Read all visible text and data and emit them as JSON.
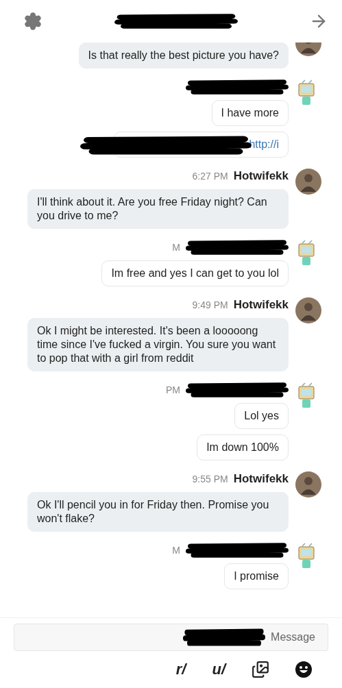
{
  "header": {
    "title_redacted": true
  },
  "groups": [
    {
      "kind": "them",
      "cut_top": true,
      "messages": [
        {
          "kind": "text",
          "text": "Is that really the best picture you have?"
        }
      ]
    },
    {
      "kind": "me",
      "header_redacted": true,
      "messages": [
        {
          "kind": "text",
          "text": "I have more"
        },
        {
          "kind": "link",
          "text": "http://i",
          "redacted": true
        }
      ]
    },
    {
      "kind": "them",
      "name": "Hotwifekk",
      "time": "6:27 PM",
      "messages": [
        {
          "kind": "text",
          "text": "I'll think about it. Are you free Friday night? Can you drive to me?"
        }
      ]
    },
    {
      "kind": "me",
      "header_redacted": true,
      "time": "M",
      "messages": [
        {
          "kind": "text",
          "text": "Im free and yes I can get to you lol"
        }
      ]
    },
    {
      "kind": "them",
      "name": "Hotwifekk",
      "time": "9:49 PM",
      "messages": [
        {
          "kind": "text",
          "text": "Ok I might be interested. It's been a looooong time since I've fucked a virgin. You sure you want to pop that with a girl from reddit"
        }
      ]
    },
    {
      "kind": "me",
      "header_redacted": true,
      "time": "PM",
      "messages": [
        {
          "kind": "text",
          "text": "Lol yes"
        },
        {
          "kind": "text",
          "text": "Im down 100%"
        }
      ]
    },
    {
      "kind": "them",
      "name": "Hotwifekk",
      "time": "9:55 PM",
      "messages": [
        {
          "kind": "text",
          "text": "Ok I'll pencil you in for Friday then. Promise you won't flake?"
        }
      ]
    },
    {
      "kind": "me",
      "header_redacted": true,
      "time": "M",
      "messages": [
        {
          "kind": "text",
          "text": "I promise"
        }
      ]
    }
  ],
  "composer": {
    "placeholder": "Message",
    "redacted": true
  },
  "toolbar": [
    {
      "kind": "text",
      "label": "r/"
    },
    {
      "kind": "text",
      "label": "u/"
    },
    {
      "kind": "gallery"
    },
    {
      "kind": "emoji"
    }
  ]
}
